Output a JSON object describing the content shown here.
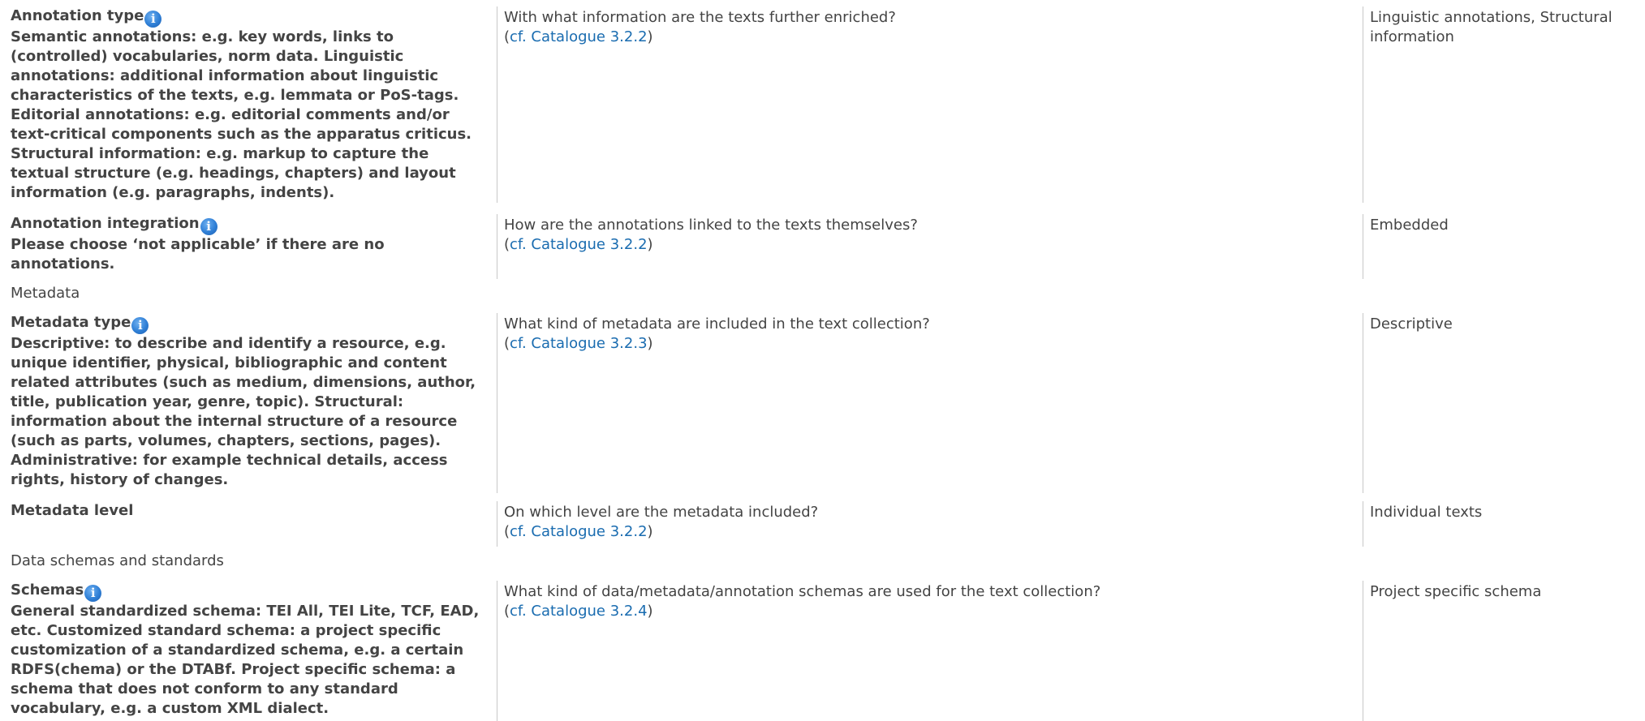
{
  "rows": [
    {
      "label": "Annotation type",
      "description": "Semantic annotations: e.g. key words, links to (controlled) vocabularies, norm data. Linguistic annotations: additional information about linguistic characteristics of the texts, e.g. lemmata or PoS-tags. Editorial annotations: e.g. editorial comments and/or text-critical components such as the apparatus criticus. Structural information: e.g. markup to capture the textual structure (e.g. headings, chapters) and layout information (e.g. paragraphs, indents).",
      "question": "With what information are the texts further enriched?",
      "link": "cf. Catalogue 3.2.2",
      "answer": "Linguistic annotations, Structural information"
    },
    {
      "label": "Annotation integration",
      "description": "Please choose ‘not applicable’ if there are no annotations.",
      "question": "How are the annotations linked to the texts themselves?",
      "link": "cf. Catalogue 3.2.2",
      "answer": "Embedded"
    },
    {
      "label": "Metadata type",
      "description": "Descriptive: to describe and identify a resource, e.g. unique identifier, physical, bibliographic and content related attributes (such as medium, dimensions, author, title, publication year, genre, topic). Structural: information about the internal structure of a resource (such as parts, volumes, chapters, sections, pages). Administrative: for example technical details, access rights, history of changes.",
      "question": "What kind of metadata are included in the text collection?",
      "link": "cf. Catalogue 3.2.3",
      "answer": "Descriptive"
    },
    {
      "label": "Metadata level",
      "question": "On which level are the metadata included?",
      "link": "cf. Catalogue 3.2.2",
      "answer": "Individual texts"
    },
    {
      "label": "Schemas",
      "description": "General standardized schema: TEI All, TEI Lite, TCF, EAD, etc. Customized standard schema: a project specific customization of a standardized schema, e.g. a certain RDFS(chema) or the DTABf. Project specific schema: a schema that does not conform to any standard vocabulary, e.g. a custom XML dialect.",
      "question": "What kind of data/metadata/annotation schemas are used for the text collection?",
      "link": "cf. Catalogue 3.2.4",
      "answer": "Project specific schema"
    }
  ],
  "sections": {
    "metadata": "Metadata",
    "data_schemas": "Data schemas and standards"
  },
  "icons": {
    "info": "info-icon"
  },
  "colors": {
    "link": "#1a6cb0",
    "info_icon": "#2f7fd6",
    "text": "#444444"
  }
}
